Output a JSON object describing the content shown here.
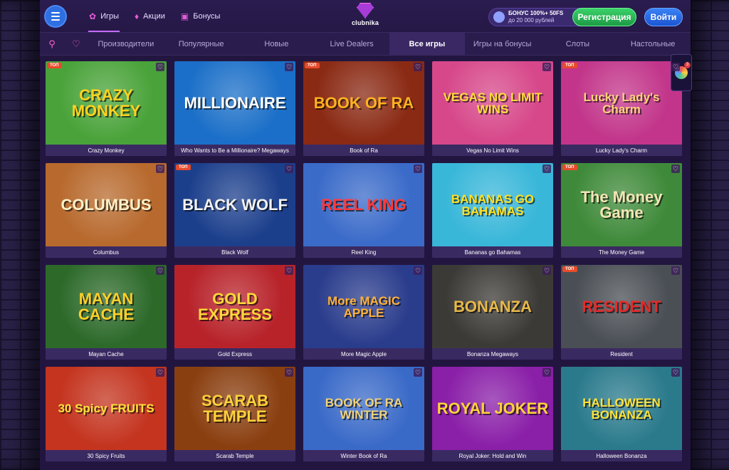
{
  "header": {
    "nav": [
      {
        "label": "Игры",
        "icon": "gamepad-icon"
      },
      {
        "label": "Акции",
        "icon": "flame-icon"
      },
      {
        "label": "Бонусы",
        "icon": "gift-icon"
      }
    ],
    "logo_text": "clubnika",
    "bonus_line1": "БОНУС 100%+ 50FS",
    "bonus_line2": "до 20 000 рублей",
    "register_label": "Регистрация",
    "login_label": "Войти"
  },
  "tabs": [
    "Производители",
    "Популярные",
    "Новые",
    "Live Dealers",
    "Все игры",
    "Игры на бонусы",
    "Слоты",
    "Настольные"
  ],
  "active_tab": "Все игры",
  "top_badge": "ТОП",
  "chat_count": "3",
  "games": [
    {
      "name": "Crazy Monkey",
      "title": "CRAZY MONKEY",
      "top": true,
      "bg": "#4aa33a",
      "color": "#ffd21f"
    },
    {
      "name": "Who Wants to Be a Millionaire? Megaways",
      "title": "MILLIONAIRE",
      "top": false,
      "bg": "#1b6fc8",
      "color": "#ffffff"
    },
    {
      "name": "Book of Ra",
      "title": "BOOK OF RA",
      "top": true,
      "bg": "#8a2a14",
      "color": "#ffb21f"
    },
    {
      "name": "Vegas No Limit Wins",
      "title": "VEGAS NO LIMIT WINS",
      "top": false,
      "bg": "#d7488a",
      "color": "#ffde3a"
    },
    {
      "name": "Lucky Lady's Charm",
      "title": "Lucky Lady's Charm",
      "top": true,
      "bg": "#c2358a",
      "color": "#ffd27a"
    },
    {
      "name": "Columbus",
      "title": "COLUMBUS",
      "top": false,
      "bg": "#b86a2e",
      "color": "#fff1c7"
    },
    {
      "name": "Black Wolf",
      "title": "BLACK WOLF",
      "top": true,
      "bg": "#1c3f8c",
      "color": "#f2f2f2"
    },
    {
      "name": "Reel King",
      "title": "REEL KING",
      "top": false,
      "bg": "#3b6bc9",
      "color": "#ff3a3a"
    },
    {
      "name": "Bananas go Bahamas",
      "title": "BANANAS GO BAHAMAS",
      "top": false,
      "bg": "#39b7d9",
      "color": "#ffe01f"
    },
    {
      "name": "The Money Game",
      "title": "The Money Game",
      "top": true,
      "bg": "#3f8a3a",
      "color": "#f4e6b5"
    },
    {
      "name": "Mayan Cache",
      "title": "MAYAN CACHE",
      "top": false,
      "bg": "#2d6a2a",
      "color": "#ffcf2a"
    },
    {
      "name": "Gold Express",
      "title": "GOLD EXPRESS",
      "top": false,
      "bg": "#b8232a",
      "color": "#ffd83a"
    },
    {
      "name": "More Magic Apple",
      "title": "More MAGIC APPLE",
      "top": false,
      "bg": "#2a3c8c",
      "color": "#ffb23a"
    },
    {
      "name": "Bonanza Megaways",
      "title": "BONANZA",
      "top": false,
      "bg": "#3c3a36",
      "color": "#e8b84a"
    },
    {
      "name": "Resident",
      "title": "RESIDENT",
      "top": true,
      "bg": "#4a4f55",
      "color": "#e62a2a"
    },
    {
      "name": "30 Spicy Fruits",
      "title": "30 Spicy FRUITS",
      "top": false,
      "bg": "#c4341f",
      "color": "#ffe23a"
    },
    {
      "name": "Scarab Temple",
      "title": "SCARAB TEMPLE",
      "top": false,
      "bg": "#8a3f10",
      "color": "#ffd23a"
    },
    {
      "name": "Winter Book of Ra",
      "title": "BOOK OF RA WINTER",
      "top": false,
      "bg": "#3a6ac8",
      "color": "#f0d27a"
    },
    {
      "name": "Royal Joker: Hold and Win",
      "title": "ROYAL JOKER",
      "top": false,
      "bg": "#8a1fa8",
      "color": "#ffd23a"
    },
    {
      "name": "Halloween Bonanza",
      "title": "HALLOWEEN BONANZA",
      "top": false,
      "bg": "#2a7a8c",
      "color": "#ffe23a"
    }
  ]
}
